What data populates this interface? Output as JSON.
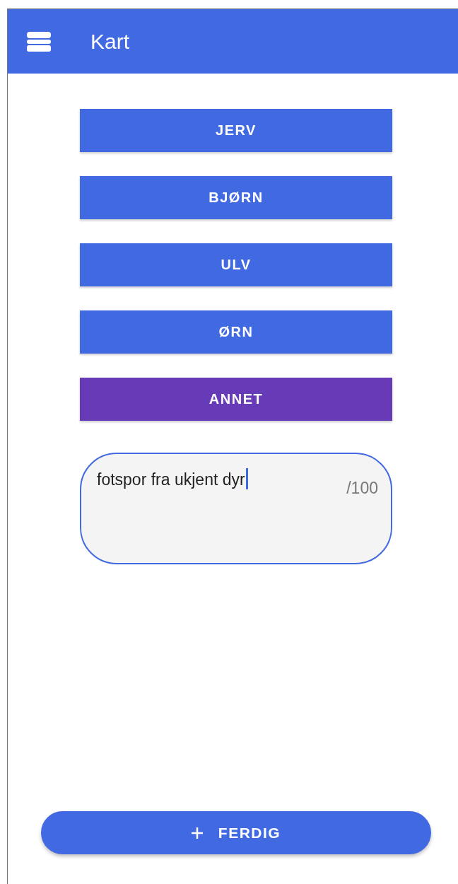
{
  "app_bar": {
    "title": "Kart"
  },
  "categories": [
    {
      "label": "JERV",
      "selected": false
    },
    {
      "label": "BJØRN",
      "selected": false
    },
    {
      "label": "ULV",
      "selected": false
    },
    {
      "label": "ØRN",
      "selected": false
    },
    {
      "label": "ANNET",
      "selected": true
    }
  ],
  "description_field": {
    "value": "fotspor fra ukjent dyr",
    "counter": "/100"
  },
  "done_button": {
    "label": "FERDIG"
  }
}
